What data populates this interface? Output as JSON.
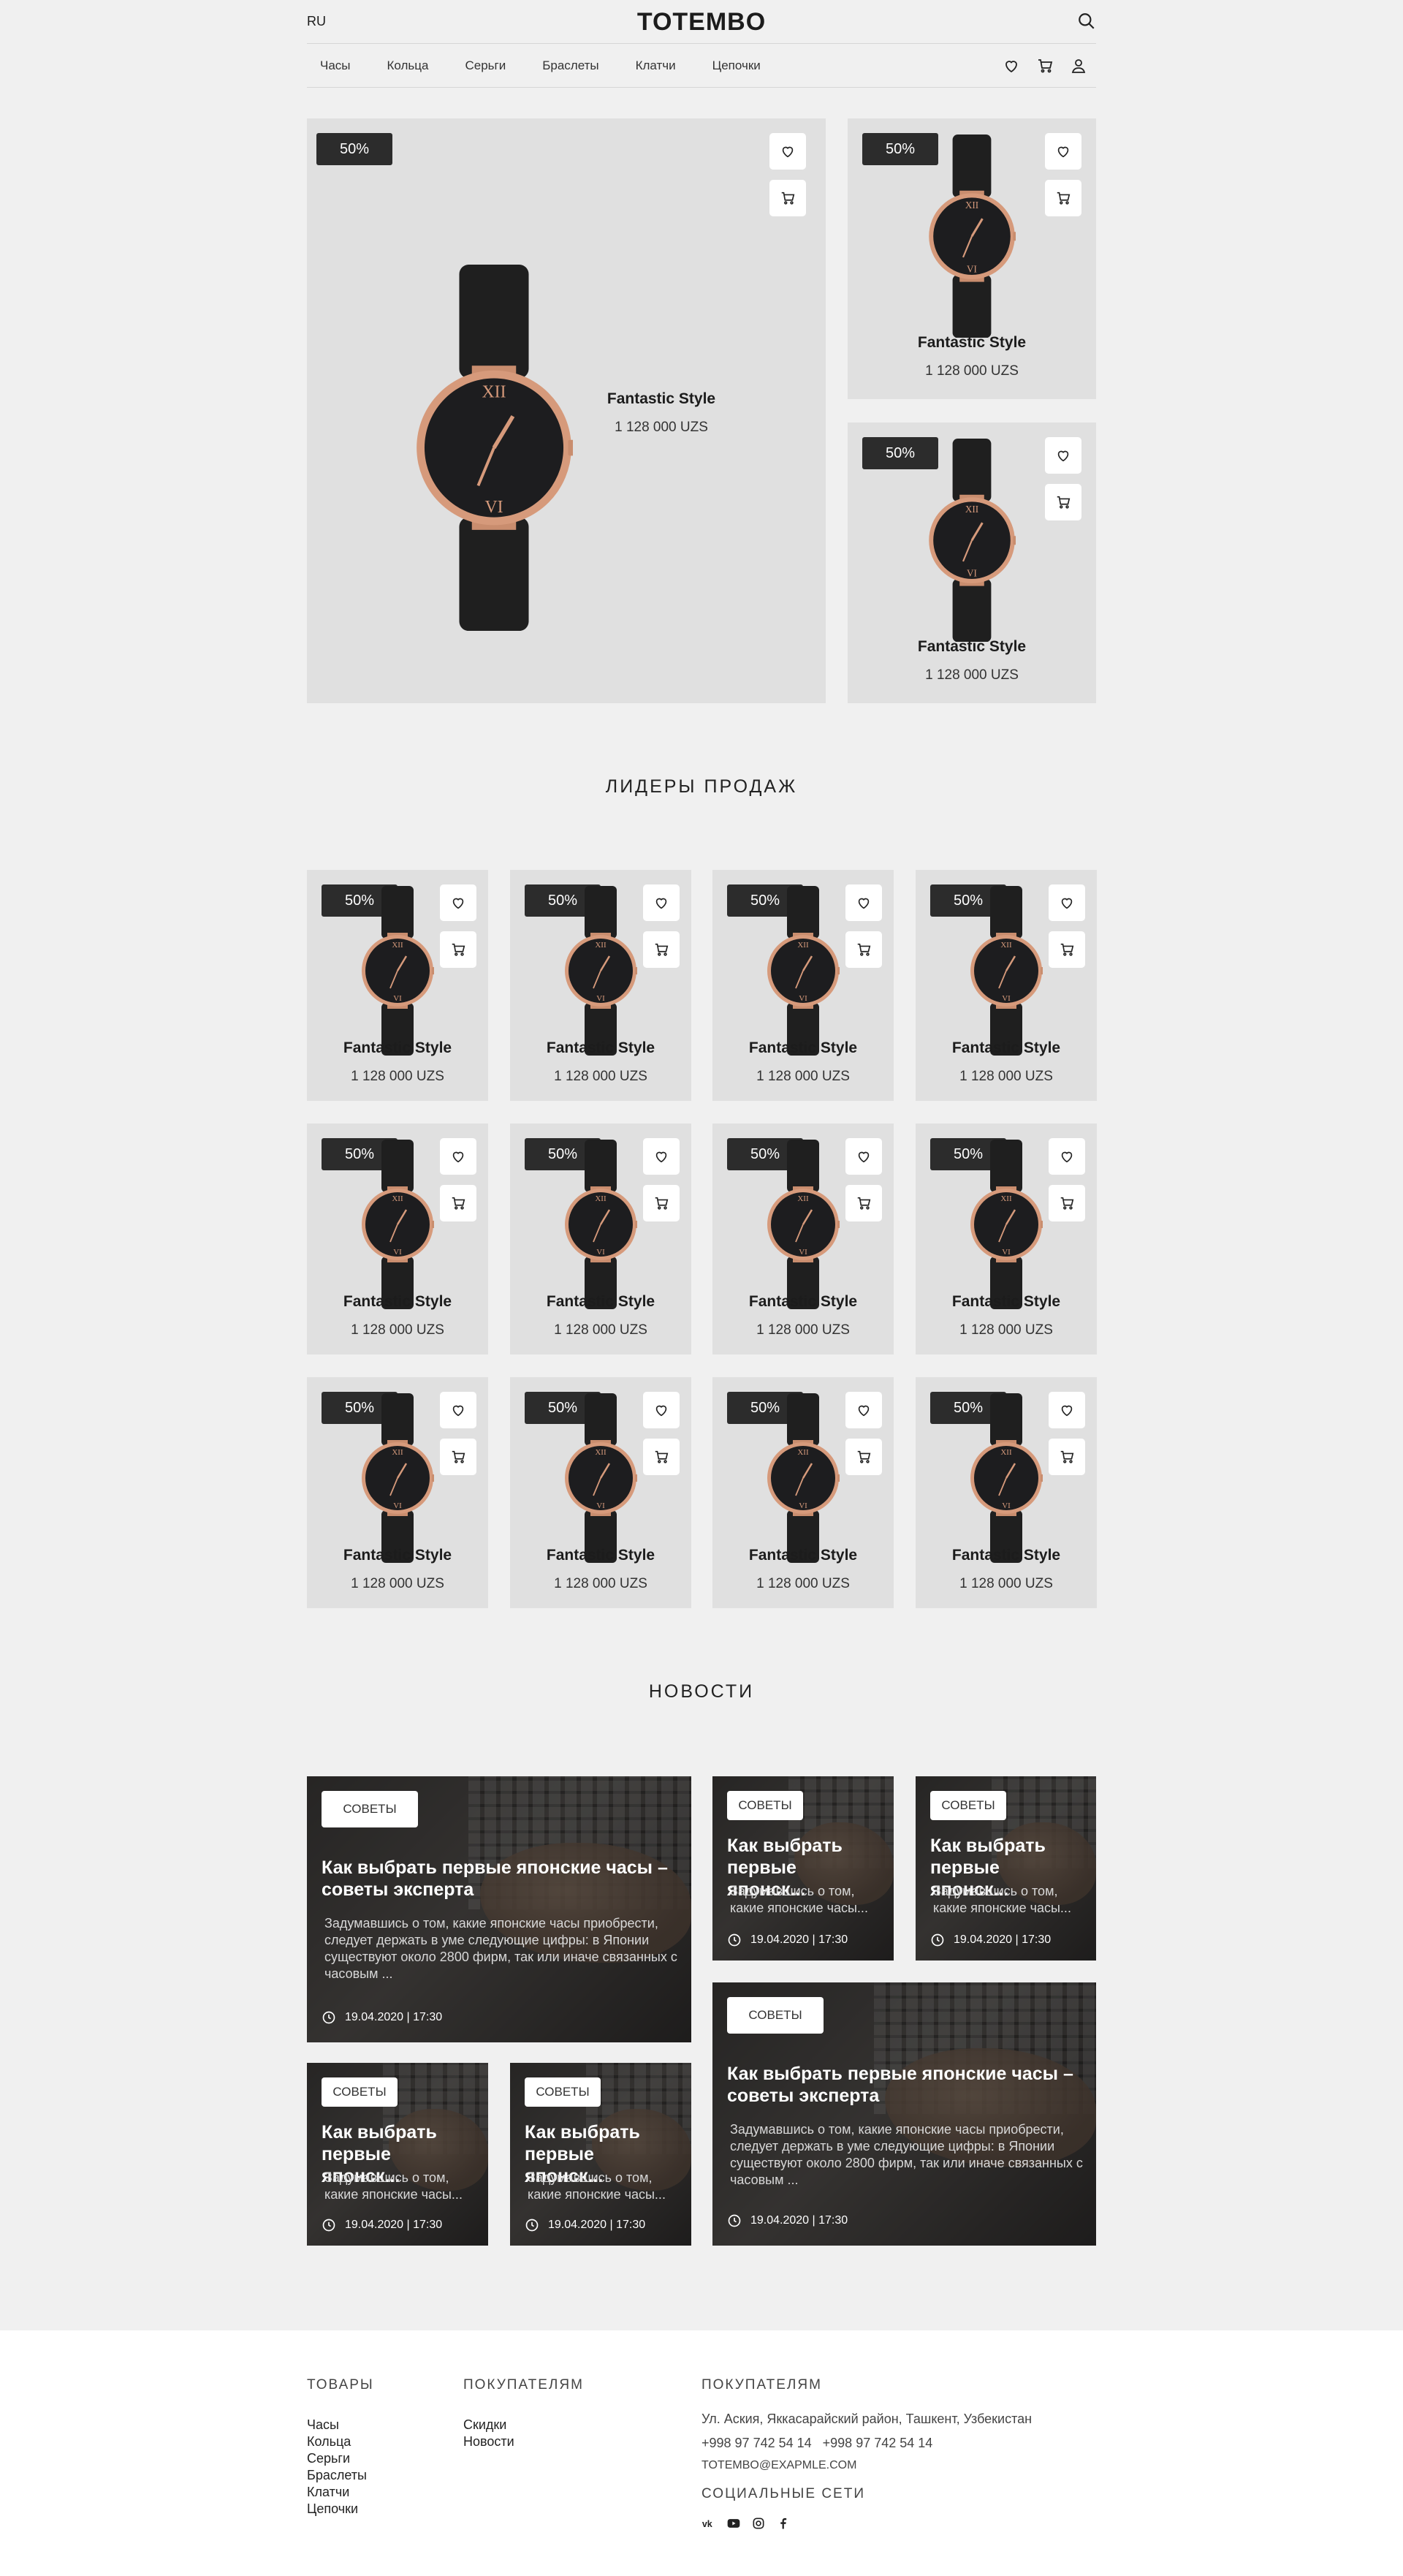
{
  "header": {
    "lang": "RU",
    "logo": "TOTEMBO"
  },
  "nav": {
    "items": [
      "Часы",
      "Кольца",
      "Серьги",
      "Браслеты",
      "Клатчи",
      "Цепочки"
    ]
  },
  "product": {
    "badge": "50%",
    "name": "Fantastic Style",
    "price": "1 128 000 UZS"
  },
  "sections": {
    "bestsellers": "ЛИДЕРЫ ПРОДАЖ",
    "news": "НОВОСТИ"
  },
  "news": {
    "tag": "СОВЕТЫ",
    "title_full": "Как выбрать первые японские часы – советы эксперта",
    "title_short": "Как выбрать первые японск...",
    "text_full": "Задумавшись о том, какие японские часы приобрести, следует держать в уме следующие цифры: в Японии существуют около 2800 фирм, так или иначе связанных с часовым ...",
    "text_short": "Задумавшись о том, какие японские часы...",
    "date": "19.04.2020 | 17:30"
  },
  "footer": {
    "goods_title": "ТОВАРЫ",
    "goods": [
      "Часы",
      "Кольца",
      "Серьги",
      "Браслеты",
      "Клатчи",
      "Цепочки"
    ],
    "buyers_title": "ПОКУПАТЕЛЯМ",
    "buyers": [
      "Скидки",
      "Новости"
    ],
    "contacts_title": "ПОКУПАТЕЛЯМ",
    "address": "Ул. Аския, Яккасарайский район, Ташкент, Узбекистан",
    "phones": "+998 97 742 54 14   +998 97 742 54 14",
    "email": "TOTEMBO@EXAPMLE.COM",
    "social_title": "СОЦИАЛЬНЫЕ СЕТИ",
    "social_icons": [
      "vk-icon",
      "youtube-icon",
      "instagram-icon",
      "facebook-icon"
    ]
  }
}
